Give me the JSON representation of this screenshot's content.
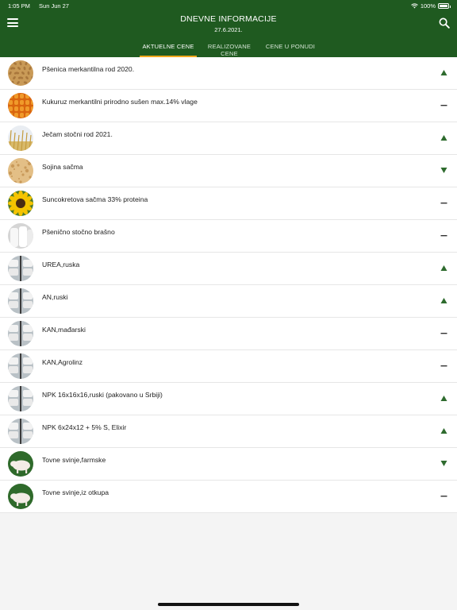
{
  "status_bar": {
    "time": "1:05 PM",
    "date": "Sun Jun 27",
    "battery": "100%"
  },
  "header": {
    "title": "DNEVNE INFORMACIJE",
    "date": "27.6.2021."
  },
  "tabs": [
    {
      "label": "AKTUELNE CENE",
      "active": true
    },
    {
      "label": "REALIZOVANE CENE",
      "active": false
    },
    {
      "label": "CENE U PONUDI",
      "active": false
    }
  ],
  "colors": {
    "header_bg": "#1f5a20",
    "tab_indicator": "#f2a81d",
    "trend_up": "#2e6b2e",
    "trend_down": "#2e6b2e"
  },
  "items": [
    {
      "name": "Pšenica merkantilna rod 2020.",
      "image": "wheat-grain",
      "trend": "up"
    },
    {
      "name": "Kukuruz merkantilni prirodno sušen max.14% vlage",
      "image": "corn",
      "trend": "neutral"
    },
    {
      "name": "Ječam stočni rod 2021.",
      "image": "barley-field",
      "trend": "up"
    },
    {
      "name": "Sojina sačma",
      "image": "soy-meal",
      "trend": "down"
    },
    {
      "name": "Suncokretova sačma 33% proteina",
      "image": "sunflower",
      "trend": "neutral"
    },
    {
      "name": "Pšenično stočno brašno",
      "image": "flour-sacks",
      "trend": "neutral"
    },
    {
      "name": "UREA,ruska",
      "image": "fertilizer-sacks",
      "trend": "up"
    },
    {
      "name": "AN,ruski",
      "image": "fertilizer-sacks",
      "trend": "up"
    },
    {
      "name": "KAN,mađarski",
      "image": "fertilizer-sacks",
      "trend": "neutral"
    },
    {
      "name": "KAN,Agrolinz",
      "image": "fertilizer-sacks",
      "trend": "neutral"
    },
    {
      "name": "NPK 16x16x16,ruski (pakovano u Srbiji)",
      "image": "fertilizer-sacks",
      "trend": "up"
    },
    {
      "name": "NPK 6x24x12 + 5% S, Elixir",
      "image": "fertilizer-sacks",
      "trend": "up"
    },
    {
      "name": "Tovne svinje,farmske",
      "image": "pig",
      "trend": "down"
    },
    {
      "name": "Tovne svinje,iz otkupa",
      "image": "pig",
      "trend": "neutral"
    }
  ]
}
